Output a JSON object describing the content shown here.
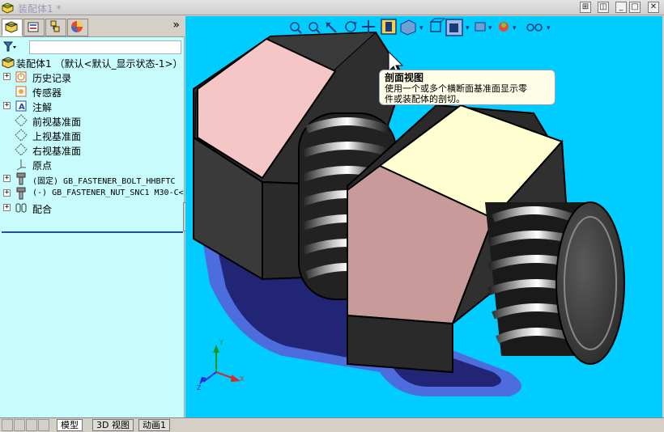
{
  "window": {
    "title": "装配体1 *"
  },
  "panel_tabs": [
    "featuremanager-tree",
    "property-manager",
    "configuration-manager",
    "display-manager"
  ],
  "tree": {
    "root": "装配体1 （默认<默认_显示状态-1>）",
    "items": [
      {
        "label": "历史记录",
        "icon": "history-icon",
        "expandable": true
      },
      {
        "label": "传感器",
        "icon": "sensor-icon",
        "expandable": false
      },
      {
        "label": "注解",
        "icon": "annotation-icon",
        "expandable": true
      },
      {
        "label": "前视基准面",
        "icon": "plane-icon",
        "expandable": false
      },
      {
        "label": "上视基准面",
        "icon": "plane-icon",
        "expandable": false
      },
      {
        "label": "右视基准面",
        "icon": "plane-icon",
        "expandable": false
      },
      {
        "label": "原点",
        "icon": "origin-icon",
        "expandable": false
      },
      {
        "label": "(固定) GB_FASTENER_BOLT_HHBFTC",
        "icon": "part-icon",
        "expandable": true
      },
      {
        "label": "(-) GB_FASTENER_NUT_SNC1 M30-C<",
        "icon": "part-icon",
        "expandable": true
      },
      {
        "label": "配合",
        "icon": "mates-icon",
        "expandable": true
      }
    ]
  },
  "tooltip": {
    "title": "剖面视图",
    "body_line1": "使用一个或多个横断面基准面显示零",
    "body_line2": "件或装配体的剖切。"
  },
  "bottom_tabs": {
    "model": "模型",
    "view3d": "3D 视图",
    "motion": "动画1"
  },
  "colors": {
    "viewport_bg": "#00ccff",
    "panel_bg": "#c8fcfc",
    "face_pink": "#f5c6c6",
    "face_yellow": "#fefed0"
  }
}
